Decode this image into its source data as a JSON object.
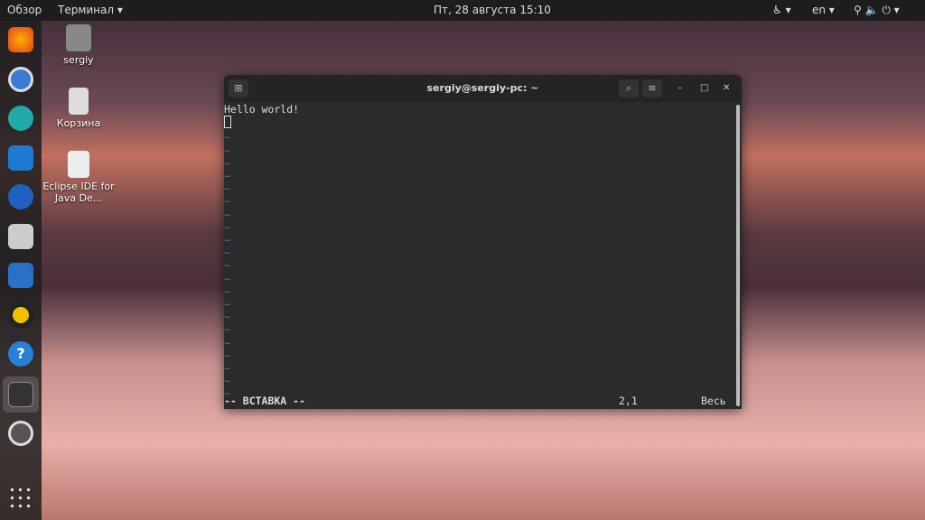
{
  "topbar": {
    "overview": "Обзор",
    "app_menu": "Терминал ▾",
    "clock": "Пт, 28 августа  15:10",
    "accessibility": "♿ ▾",
    "language": "en ▾",
    "system": "⚲ 🔈 ⏻ ▾"
  },
  "desktop": [
    {
      "label": "sergiy"
    },
    {
      "label": "Корзина"
    },
    {
      "label": "Eclipse IDE for Java De..."
    }
  ],
  "terminal": {
    "title": "sergiy@sergiy-pc: ~",
    "line1": "Hello world!",
    "tilde": "~",
    "mode": "-- ВСТАВКА --",
    "position": "2,1",
    "scroll": "Весь"
  },
  "dock": [
    "firefox",
    "chromium",
    "crossover",
    "vscode",
    "thunderbird",
    "files",
    "libreoffice-writer",
    "rhythmbox",
    "help",
    "terminal",
    "settings",
    "app-grid"
  ]
}
